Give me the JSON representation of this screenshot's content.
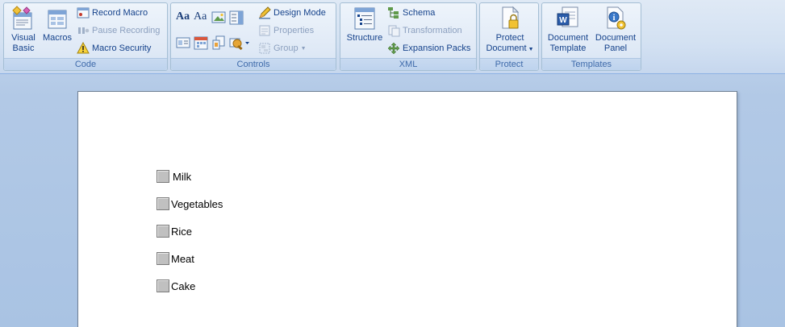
{
  "ribbon": {
    "code": {
      "caption": "Code",
      "visual_basic": "Visual\nBasic",
      "macros": "Macros",
      "record_macro": "Record Macro",
      "pause_recording": "Pause Recording",
      "macro_security": "Macro Security"
    },
    "controls": {
      "caption": "Controls",
      "design_mode": "Design Mode",
      "properties": "Properties",
      "group": "Group",
      "aa_bold": "Aa",
      "aa_plain": "Aa"
    },
    "xml": {
      "caption": "XML",
      "structure": "Structure",
      "schema": "Schema",
      "transformation": "Transformation",
      "expansion_packs": "Expansion Packs"
    },
    "protect": {
      "caption": "Protect",
      "protect_document_line1": "Protect",
      "protect_document_line2": "Document"
    },
    "templates": {
      "caption": "Templates",
      "document_template_line1": "Document",
      "document_template_line2": "Template",
      "document_panel_line1": "Document",
      "document_panel_line2": "Panel"
    }
  },
  "document": {
    "checklist": [
      {
        "label": "Milk",
        "checked": false
      },
      {
        "label": "Vegetables",
        "checked": false
      },
      {
        "label": "Rice",
        "checked": false
      },
      {
        "label": "Meat",
        "checked": false
      },
      {
        "label": "Cake",
        "checked": false
      }
    ]
  }
}
